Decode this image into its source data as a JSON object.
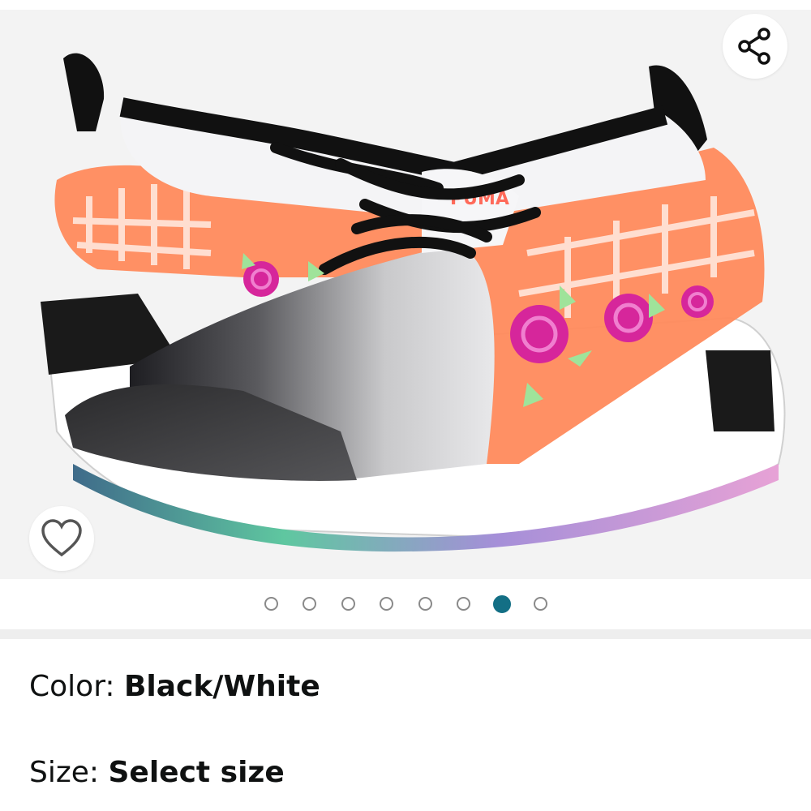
{
  "gallery": {
    "image_alt": "PUMA sneaker with black and white satin upper, orange lattice overlay and pink rose appliqués",
    "total_images": 8,
    "active_index": 6
  },
  "icons": {
    "share": "share-icon",
    "favorite": "heart-outline-icon"
  },
  "colors": {
    "active_dot": "#136f85",
    "inactive_dot": "#8a8a8a",
    "text": "#0f1111"
  },
  "options": {
    "color_label": "Color: ",
    "color_value": "Black/White",
    "size_label": "Size: ",
    "size_value": "Select size"
  }
}
